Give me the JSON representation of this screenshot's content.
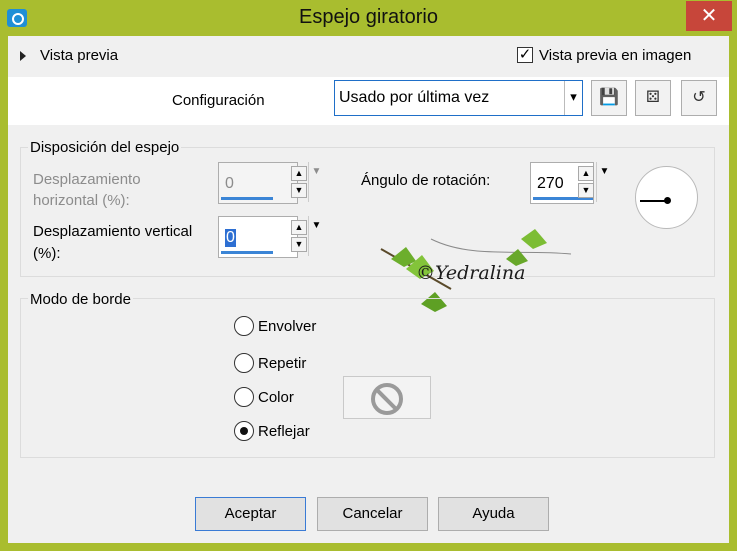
{
  "window": {
    "title": "Espejo giratorio",
    "close_glyph": "✕"
  },
  "preview": {
    "toggle_label": "Vista previa",
    "checkbox_label": "Vista previa en imagen",
    "checkbox_checked": true
  },
  "config": {
    "label": "Configuración",
    "preset_value": "Usado por última vez",
    "buttons": [
      "save-preset-icon",
      "randomize-icon",
      "reset-icon"
    ]
  },
  "mirror_layout": {
    "group_label": "Disposición del espejo",
    "horizontal_label_1": "Desplazamiento",
    "horizontal_label_2": "horizontal (%):",
    "horizontal_value": "0",
    "vertical_label_1": "Desplazamiento vertical",
    "vertical_label_2": "(%):",
    "vertical_value": "0",
    "rotation_label": "Ángulo de rotación:",
    "rotation_value": "270"
  },
  "watermark": {
    "text": "©Yedralina"
  },
  "border_mode": {
    "group_label": "Modo de borde",
    "options": [
      {
        "label": "Envolver",
        "checked": false
      },
      {
        "label": "Repetir",
        "checked": false
      },
      {
        "label": "Color",
        "checked": false
      },
      {
        "label": "Reflejar",
        "checked": true
      }
    ]
  },
  "footer": {
    "ok": "Aceptar",
    "cancel": "Cancelar",
    "help": "Ayuda"
  }
}
